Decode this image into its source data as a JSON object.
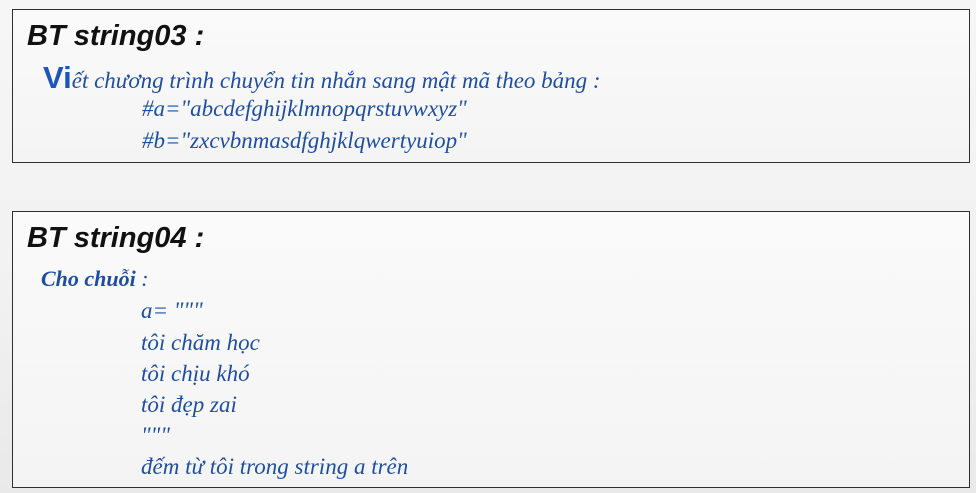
{
  "exercise1": {
    "title": "BT string03 :",
    "intro_initial": "Vi",
    "intro_text": "ết chương trình chuyển tin nhắn sang mật mã theo bảng :",
    "line_a": "#a=\"abcdefghijklmnopqrstuvwxyz\"",
    "line_b": "#b=\"zxcvbnmasdfghjklqwertyuiop\""
  },
  "exercise2": {
    "title": "BT string04 :",
    "cho_label": "Cho chuỗi",
    "cho_colon": " :",
    "lines": [
      "a= \"\"\"",
      "tôi chăm học",
      "tôi chịu khó",
      "tôi đẹp zai",
      "\"\"\"",
      "đếm từ tôi trong string a trên"
    ]
  }
}
